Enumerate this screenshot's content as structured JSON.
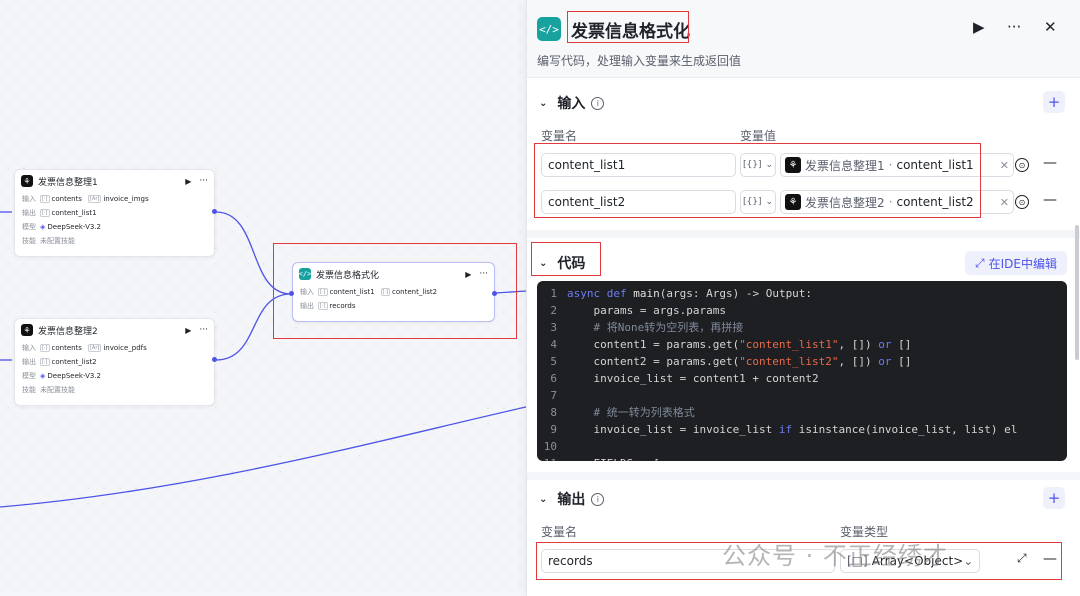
{
  "canvas": {
    "nodes": [
      {
        "title": "发票信息整理1",
        "rows": [
          {
            "label": "输入",
            "chips": [
              {
                "type": "[·]",
                "text": "contents"
              },
              {
                "type": "[Ar]",
                "text": "invoice_imgs"
              }
            ]
          },
          {
            "label": "输出",
            "chips": [
              {
                "type": "[·]",
                "text": "content_list1"
              }
            ]
          },
          {
            "label": "模型",
            "chips": [
              {
                "type": "◈",
                "text": "DeepSeek-V3.2"
              }
            ]
          },
          {
            "label": "技能",
            "value": "未配置技能"
          }
        ]
      },
      {
        "title": "发票信息整理2",
        "rows": [
          {
            "label": "输入",
            "chips": [
              {
                "type": "[·]",
                "text": "contents"
              },
              {
                "type": "[Ar]",
                "text": "invoice_pdfs"
              }
            ]
          },
          {
            "label": "输出",
            "chips": [
              {
                "type": "[·]",
                "text": "content_list2"
              }
            ]
          },
          {
            "label": "模型",
            "chips": [
              {
                "type": "◈",
                "text": "DeepSeek-V3.2"
              }
            ]
          },
          {
            "label": "技能",
            "value": "未配置技能"
          }
        ]
      },
      {
        "title": "发票信息格式化",
        "rows": [
          {
            "label": "输入",
            "chips": [
              {
                "type": "[·]",
                "text": "content_list1"
              },
              {
                "type": "[·]",
                "text": "content_list2"
              }
            ]
          },
          {
            "label": "输出",
            "chips": [
              {
                "type": "[·]",
                "text": "records"
              }
            ]
          }
        ]
      }
    ]
  },
  "panel": {
    "title": "发票信息格式化",
    "description": "编写代码，处理输入变量来生成返回值",
    "input": {
      "section": "输入",
      "col_name": "变量名",
      "col_value": "变量值",
      "rows": [
        {
          "name": "content_list1",
          "type": "[{}]",
          "source": "发票信息整理1",
          "var": "content_list1"
        },
        {
          "name": "content_list2",
          "type": "[{}]",
          "source": "发票信息整理2",
          "var": "content_list2"
        }
      ]
    },
    "code": {
      "section": "代码",
      "ide_label": "在IDE中编辑",
      "lines": [
        {
          "n": "1",
          "parts": [
            {
              "c": "kw",
              "t": "async def "
            },
            {
              "c": "fn",
              "t": "main"
            },
            {
              "c": "ct",
              "t": "(args: Args) -> Output:"
            }
          ]
        },
        {
          "n": "2",
          "parts": [
            {
              "c": "ct",
              "t": "    params = args.params"
            }
          ]
        },
        {
          "n": "3",
          "parts": [
            {
              "c": "cm",
              "t": "    # 将None转为空列表，再拼接"
            }
          ]
        },
        {
          "n": "4",
          "parts": [
            {
              "c": "ct",
              "t": "    content1 = params.get("
            },
            {
              "c": "str",
              "t": "\"content_list1\""
            },
            {
              "c": "ct",
              "t": ", []) "
            },
            {
              "c": "kw",
              "t": "or"
            },
            {
              "c": "ct",
              "t": " []"
            }
          ]
        },
        {
          "n": "5",
          "parts": [
            {
              "c": "ct",
              "t": "    content2 = params.get("
            },
            {
              "c": "str",
              "t": "\"content_list2\""
            },
            {
              "c": "ct",
              "t": ", []) "
            },
            {
              "c": "kw",
              "t": "or"
            },
            {
              "c": "ct",
              "t": " []"
            }
          ]
        },
        {
          "n": "6",
          "parts": [
            {
              "c": "ct",
              "t": "    invoice_list = content1 + content2"
            }
          ]
        },
        {
          "n": "7",
          "parts": [
            {
              "c": "ct",
              "t": ""
            }
          ]
        },
        {
          "n": "8",
          "parts": [
            {
              "c": "cm",
              "t": "    # 统一转为列表格式"
            }
          ]
        },
        {
          "n": "9",
          "parts": [
            {
              "c": "ct",
              "t": "    invoice_list = invoice_list "
            },
            {
              "c": "kw",
              "t": "if"
            },
            {
              "c": "ct",
              "t": " isinstance(invoice_list, list) el"
            }
          ]
        },
        {
          "n": "10",
          "parts": [
            {
              "c": "ct",
              "t": ""
            }
          ]
        },
        {
          "n": "11",
          "parts": [
            {
              "c": "ct",
              "t": "    FIELDS = ["
            }
          ]
        }
      ]
    },
    "output": {
      "section": "输出",
      "col_name": "变量名",
      "col_type": "变量类型",
      "rows": [
        {
          "name": "records",
          "type": "Array<Object>"
        }
      ]
    },
    "watermark": "公众号 · 不正经绣才"
  },
  "colors": {
    "accent": "#4d53e8",
    "code_icon": "#17a2a0",
    "highlight": "#e0393e"
  }
}
